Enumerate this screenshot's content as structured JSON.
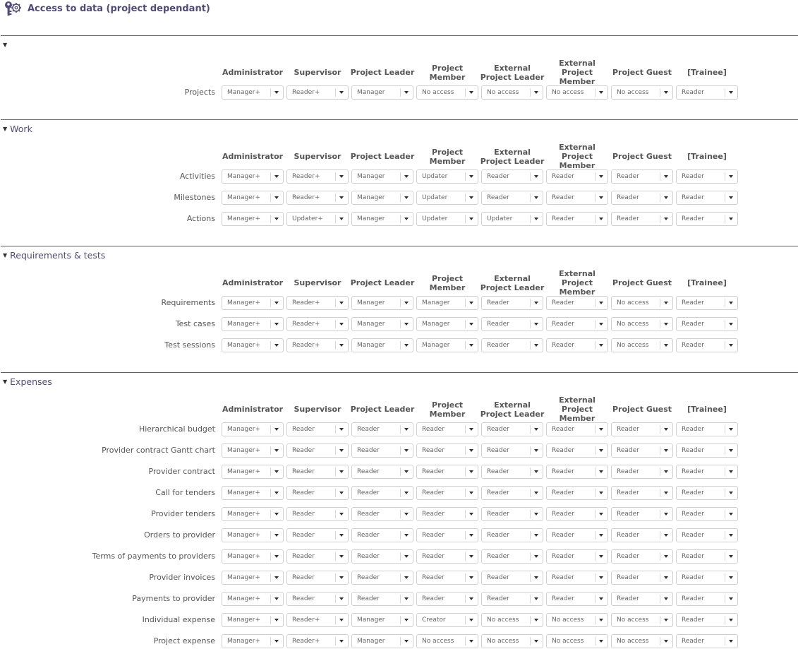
{
  "header": {
    "title": "Access to data (project dependant)",
    "icon": "key-gear-icon"
  },
  "columns": [
    "Administrator",
    "Supervisor",
    "Project Leader",
    "Project Member",
    "External Project Leader",
    "External Project Member",
    "Project Guest",
    "[Trainee]"
  ],
  "sections": [
    {
      "title": "",
      "rows": [
        {
          "label": "Projects",
          "values": [
            "Manager+",
            "Reader+",
            "Manager",
            "No access",
            "No access",
            "No access",
            "No access",
            "Reader"
          ]
        }
      ]
    },
    {
      "title": "Work",
      "rows": [
        {
          "label": "Activities",
          "values": [
            "Manager+",
            "Reader+",
            "Manager",
            "Updater",
            "Reader",
            "Reader",
            "Reader",
            "Reader"
          ]
        },
        {
          "label": "Milestones",
          "values": [
            "Manager+",
            "Reader+",
            "Manager",
            "Updater",
            "Reader",
            "Reader",
            "Reader",
            "Reader"
          ]
        },
        {
          "label": "Actions",
          "values": [
            "Manager+",
            "Updater+",
            "Manager",
            "Updater",
            "Updater",
            "Reader",
            "Reader",
            "Reader"
          ]
        }
      ]
    },
    {
      "title": "Requirements & tests",
      "rows": [
        {
          "label": "Requirements",
          "values": [
            "Manager+",
            "Reader+",
            "Manager",
            "Manager",
            "Reader",
            "Reader",
            "No access",
            "Reader"
          ]
        },
        {
          "label": "Test cases",
          "values": [
            "Manager+",
            "Reader+",
            "Manager",
            "Manager",
            "Reader",
            "Reader",
            "No access",
            "Reader"
          ]
        },
        {
          "label": "Test sessions",
          "values": [
            "Manager+",
            "Reader+",
            "Manager",
            "Manager",
            "Reader",
            "Reader",
            "No access",
            "Reader"
          ]
        }
      ]
    },
    {
      "title": "Expenses",
      "rows": [
        {
          "label": "Hierarchical budget",
          "values": [
            "Manager+",
            "Reader",
            "Reader",
            "Reader",
            "Reader",
            "Reader",
            "Reader",
            "Reader"
          ]
        },
        {
          "label": "Provider contract Gantt chart",
          "values": [
            "Manager+",
            "Reader",
            "Reader",
            "Reader",
            "Reader",
            "Reader",
            "Reader",
            "Reader"
          ]
        },
        {
          "label": "Provider contract",
          "values": [
            "Manager+",
            "Reader",
            "Reader",
            "Reader",
            "Reader",
            "Reader",
            "Reader",
            "Reader"
          ]
        },
        {
          "label": "Call for tenders",
          "values": [
            "Manager+",
            "Reader",
            "Reader",
            "Reader",
            "Reader",
            "Reader",
            "Reader",
            "Reader"
          ]
        },
        {
          "label": "Provider tenders",
          "values": [
            "Manager+",
            "Reader",
            "Reader",
            "Reader",
            "Reader",
            "Reader",
            "Reader",
            "Reader"
          ]
        },
        {
          "label": "Orders to provider",
          "values": [
            "Manager+",
            "Reader",
            "Reader",
            "Reader",
            "Reader",
            "Reader",
            "Reader",
            "Reader"
          ]
        },
        {
          "label": "Terms of payments to providers",
          "values": [
            "Manager+",
            "Reader",
            "Reader",
            "Reader",
            "Reader",
            "Reader",
            "Reader",
            "Reader"
          ]
        },
        {
          "label": "Provider invoices",
          "values": [
            "Manager+",
            "Reader",
            "Reader",
            "Reader",
            "Reader",
            "Reader",
            "Reader",
            "Reader"
          ]
        },
        {
          "label": "Payments to provider",
          "values": [
            "Manager+",
            "Reader",
            "Reader",
            "Reader",
            "Reader",
            "Reader",
            "Reader",
            "Reader"
          ]
        },
        {
          "label": "Individual expense",
          "values": [
            "Manager+",
            "Reader+",
            "Manager",
            "Creator",
            "No access",
            "No access",
            "No access",
            "Reader"
          ]
        },
        {
          "label": "Project expense",
          "values": [
            "Manager+",
            "Reader+",
            "Manager",
            "No access",
            "No access",
            "No access",
            "No access",
            "Reader"
          ]
        }
      ]
    }
  ]
}
